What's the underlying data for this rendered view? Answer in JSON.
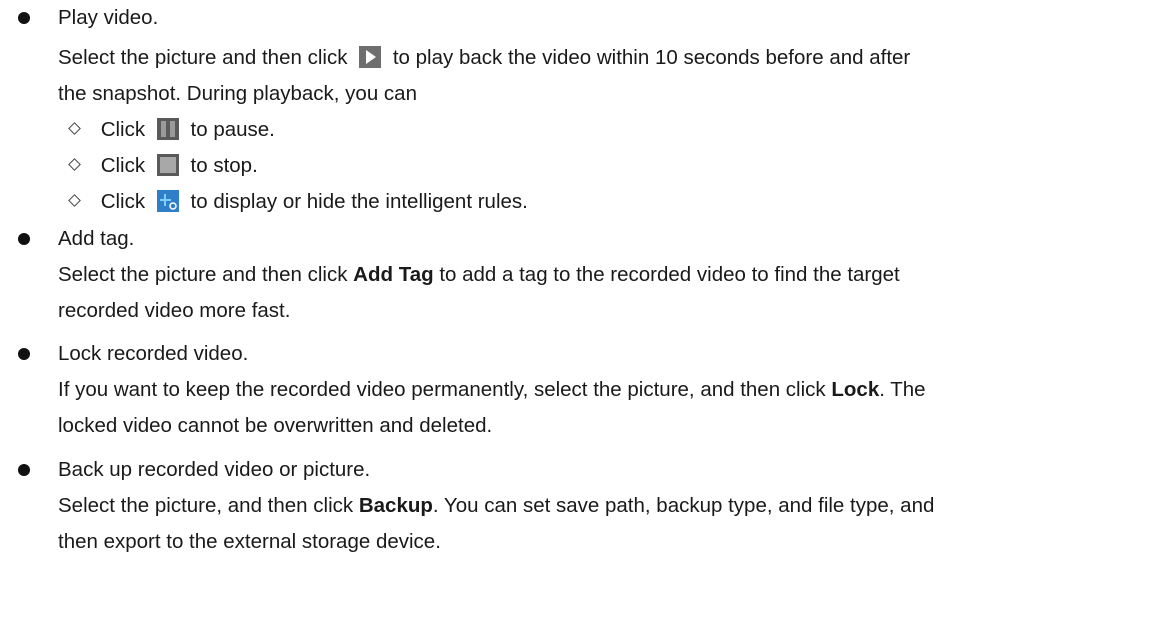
{
  "sections": [
    {
      "title": "Play video.",
      "line1_pre": "Select the picture and then click",
      "line1_post": "to play back the video within 10 seconds before and after",
      "line2": "the snapshot. During playback, you can",
      "subitems": [
        {
          "pre": "Click",
          "post": "to pause.",
          "icon": "pause-icon"
        },
        {
          "pre": "Click",
          "post": "to stop.",
          "icon": "stop-icon"
        },
        {
          "pre": "Click",
          "post": "to display or hide the intelligent rules.",
          "icon": "intelligent-rules-icon"
        }
      ],
      "icon": "play-icon"
    },
    {
      "title": "Add tag.",
      "line1_pre": "Select the picture and then click",
      "line1_bold": "Add Tag",
      "line1_post": "to add a tag to the recorded video to find the target",
      "line2": "recorded video more fast."
    },
    {
      "title": "Lock recorded video.",
      "line1_pre": "If you want to keep the recorded video permanently, select the picture, and then click",
      "line1_bold": "Lock",
      "line1_post": ". The",
      "line2": "locked video cannot be overwritten and deleted."
    },
    {
      "title": "Back up recorded video or picture.",
      "line1_pre": "Select the picture, and then click",
      "line1_bold": "Backup",
      "line1_post": ". You can set save path, backup type, and file type, and",
      "line2": "then export to the external storage device."
    }
  ],
  "colors": {
    "text": "#1a1a1a",
    "icon_gray": "#6b6b6b",
    "icon_blue": "#1e90d6"
  }
}
